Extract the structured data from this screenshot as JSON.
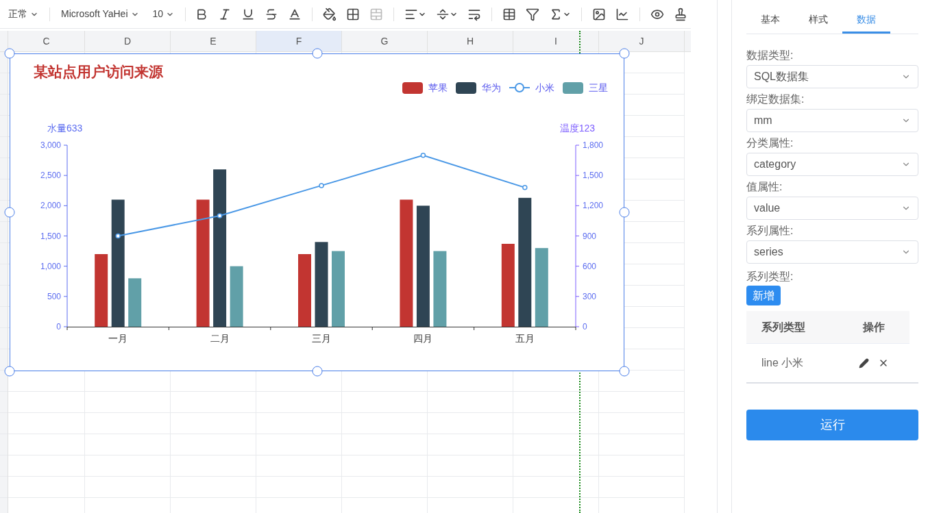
{
  "toolbar": {
    "style_select": "正常",
    "font_select": "Microsoft YaHei",
    "size_select": "10",
    "tools": [
      {
        "kind": "bold",
        "disabled": false
      },
      {
        "kind": "italic",
        "disabled": false
      },
      {
        "kind": "underline",
        "disabled": false
      },
      {
        "kind": "strike",
        "disabled": false
      },
      {
        "kind": "font-color",
        "disabled": false
      },
      {
        "kind": "fill",
        "disabled": false
      },
      {
        "kind": "borders",
        "disabled": false
      },
      {
        "kind": "merge",
        "disabled": true
      },
      {
        "kind": "align",
        "disabled": false
      },
      {
        "kind": "valign",
        "disabled": false
      },
      {
        "kind": "wrap",
        "disabled": false
      },
      {
        "kind": "table",
        "disabled": false
      },
      {
        "kind": "filter",
        "disabled": false
      },
      {
        "kind": "sum",
        "disabled": false
      },
      {
        "kind": "image",
        "disabled": false
      },
      {
        "kind": "chart",
        "disabled": false
      },
      {
        "kind": "preview",
        "disabled": false
      },
      {
        "kind": "stamp",
        "disabled": false
      }
    ]
  },
  "columns": [
    {
      "label": "C",
      "selected": false
    },
    {
      "label": "D",
      "selected": false
    },
    {
      "label": "E",
      "selected": false
    },
    {
      "label": "F",
      "selected": true
    },
    {
      "label": "G",
      "selected": false
    },
    {
      "label": "H",
      "selected": false
    },
    {
      "label": "I",
      "selected": false
    },
    {
      "label": "J",
      "selected": false
    }
  ],
  "chart": {
    "chart_data": {
      "type": "bar",
      "title": "某站点用户访问来源",
      "ylabel": "水量633",
      "y2label": "温度123",
      "categories": [
        "一月",
        "二月",
        "三月",
        "四月",
        "五月"
      ],
      "legend": true,
      "ylim": [
        0,
        3000
      ],
      "yticks": [
        {
          "value": 0,
          "label": "0"
        },
        {
          "value": 500,
          "label": "500"
        },
        {
          "value": 1000,
          "label": "1,000"
        },
        {
          "value": 1500,
          "label": "1,500"
        },
        {
          "value": 2000,
          "label": "2,000"
        },
        {
          "value": 2500,
          "label": "2,500"
        },
        {
          "value": 3000,
          "label": "3,000"
        }
      ],
      "y2lim": [
        0,
        1800
      ],
      "y2ticks": [
        {
          "value": 0,
          "label": "0"
        },
        {
          "value": 300,
          "label": "300"
        },
        {
          "value": 600,
          "label": "600"
        },
        {
          "value": 900,
          "label": "900"
        },
        {
          "value": 1200,
          "label": "1,200"
        },
        {
          "value": 1500,
          "label": "1,500"
        },
        {
          "value": 1800,
          "label": "1,800"
        }
      ],
      "series": [
        {
          "name": "苹果",
          "type": "bar",
          "color": "#c23531",
          "values": [
            1200,
            2100,
            1200,
            2100,
            1370
          ]
        },
        {
          "name": "华为",
          "type": "bar",
          "color": "#2f4554",
          "values": [
            2100,
            2600,
            1400,
            2000,
            2130
          ]
        },
        {
          "name": "小米",
          "type": "line",
          "axis": "y2",
          "marker": "circle",
          "color": "#4a98e6",
          "values": [
            900,
            1100,
            1400,
            1700,
            1380
          ]
        },
        {
          "name": "三星",
          "type": "bar",
          "color": "#61a0a8",
          "values": [
            800,
            1000,
            1250,
            1250,
            1300
          ]
        }
      ]
    }
  },
  "panel": {
    "tabs": [
      {
        "label": "基本",
        "selected": false
      },
      {
        "label": "样式",
        "selected": false
      },
      {
        "label": "数据",
        "selected": true
      }
    ],
    "fields": [
      {
        "label": "数据类型:",
        "value": "SQL数据集"
      },
      {
        "label": "绑定数据集:",
        "value": "mm"
      },
      {
        "label": "分类属性:",
        "value": "category"
      },
      {
        "label": "值属性:",
        "value": "value"
      },
      {
        "label": "系列属性:",
        "value": "series"
      }
    ],
    "series_type_label": "系列类型:",
    "add_button": "新增",
    "table": {
      "columns": [
        "系列类型",
        "操作"
      ],
      "rows": [
        {
          "series": "line 小米"
        }
      ]
    },
    "run_button": "运行"
  }
}
